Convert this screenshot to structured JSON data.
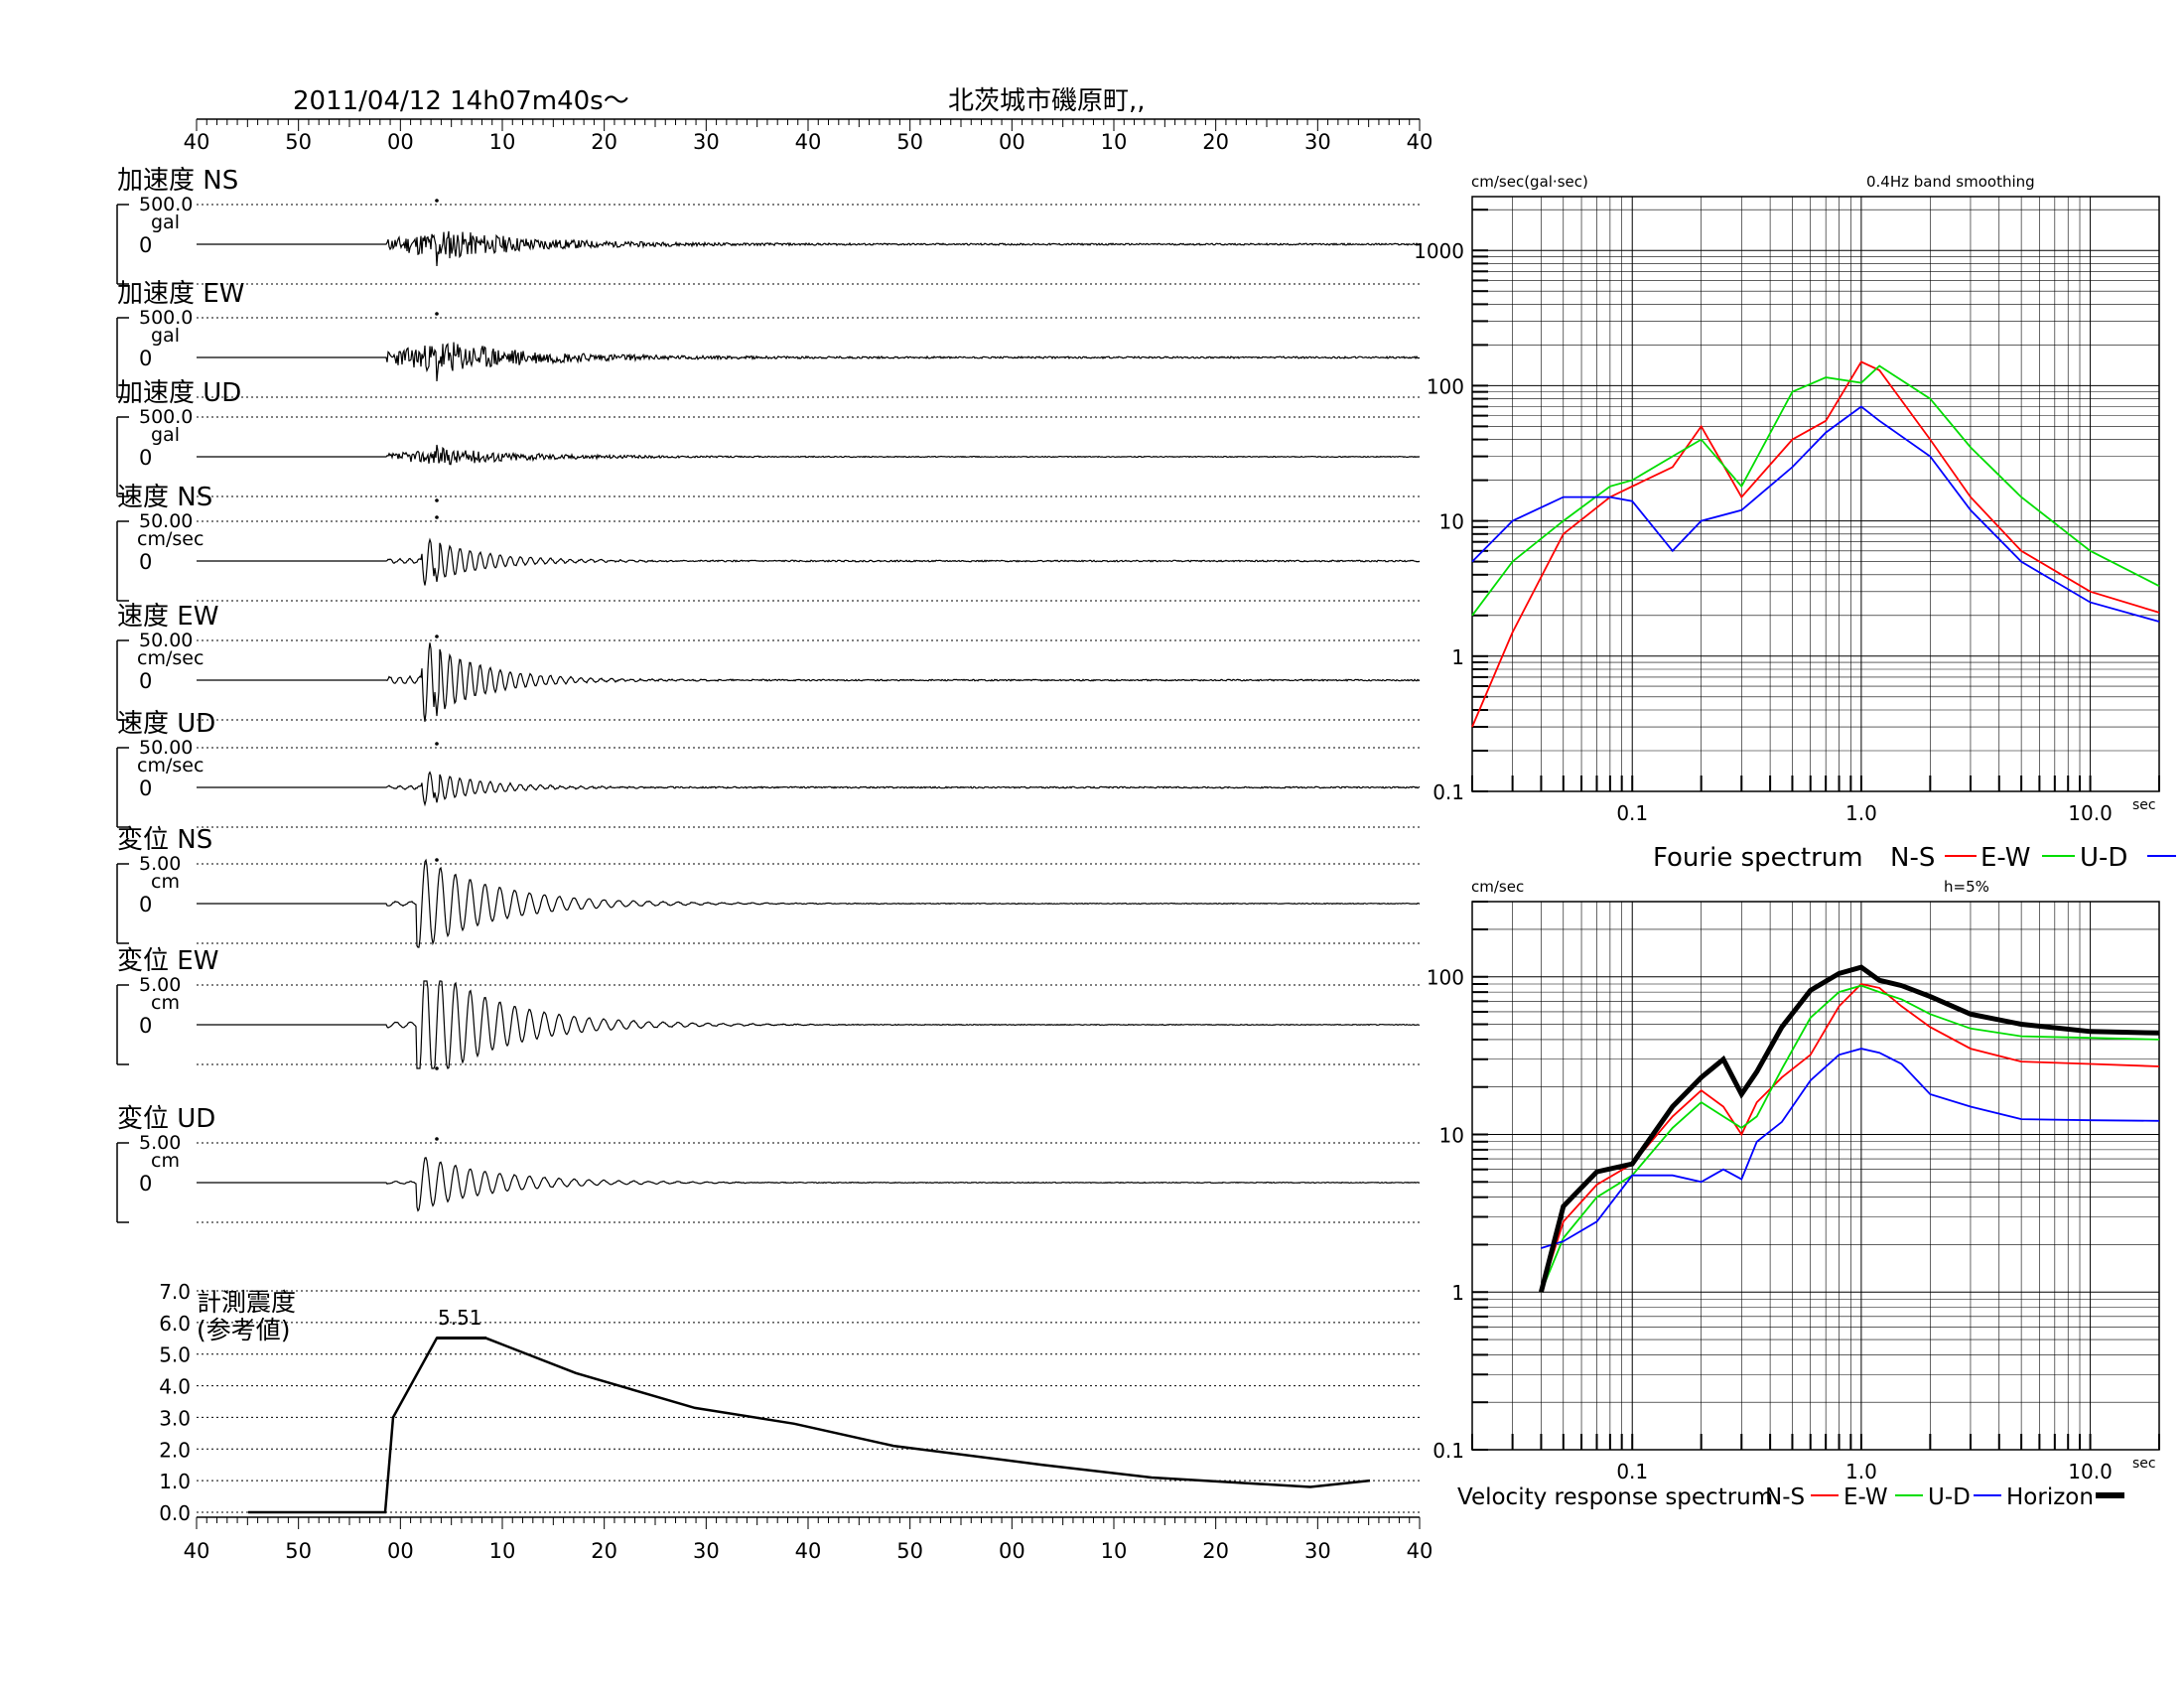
{
  "header": {
    "datetime": "2011/04/12  14h07m40s～",
    "location": "北茨城市磯原町,,"
  },
  "time_axis": {
    "tick_labels": [
      "40",
      "50",
      "00",
      "10",
      "20",
      "30",
      "40",
      "50",
      "00",
      "10",
      "20",
      "30",
      "40"
    ]
  },
  "channels": [
    {
      "title": "加速度 NS",
      "scale": "500.0",
      "unit": "gal",
      "zero": "0",
      "kind": "acc",
      "seed": 11,
      "amp": 0.55,
      "peak_dir": 1
    },
    {
      "title": "加速度 EW",
      "scale": "500.0",
      "unit": "gal",
      "zero": "0",
      "kind": "acc",
      "seed": 23,
      "amp": 0.6,
      "peak_dir": 1
    },
    {
      "title": "加速度 UD",
      "scale": "500.0",
      "unit": "gal",
      "zero": "0",
      "kind": "acc",
      "seed": 37,
      "amp": 0.3,
      "peak_dir": -1
    },
    {
      "title": "速度 NS",
      "scale": "50.00",
      "unit": "cm/sec",
      "zero": "0",
      "kind": "vel",
      "seed": 41,
      "amp": 0.55,
      "peak_dir": 1
    },
    {
      "title": "速度 EW",
      "scale": "50.00",
      "unit": "cm/sec",
      "zero": "0",
      "kind": "vel",
      "seed": 53,
      "amp": 0.95,
      "peak_dir": 1
    },
    {
      "title": "速度 UD",
      "scale": "50.00",
      "unit": "cm/sec",
      "zero": "0",
      "kind": "vel",
      "seed": 67,
      "amp": 0.4,
      "peak_dir": 1
    },
    {
      "title": "変位 NS",
      "scale": "5.00",
      "unit": "cm",
      "zero": "0",
      "kind": "dis",
      "seed": 71,
      "amp": 0.95,
      "peak_dir": 1
    },
    {
      "title": "変位 EW",
      "scale": "5.00",
      "unit": "cm",
      "zero": "0",
      "kind": "dis",
      "seed": 83,
      "amp": 1.35,
      "peak_dir": -1
    },
    {
      "title": "変位 UD",
      "scale": "5.00",
      "unit": "cm",
      "zero": "0",
      "kind": "dis",
      "seed": 97,
      "amp": 0.55,
      "peak_dir": 1
    }
  ],
  "intensity_panel": {
    "title_line1": "計測震度",
    "title_line2": "(参考値)",
    "peak_label": "5.51",
    "y_tick_labels": [
      "7.0",
      "6.0",
      "5.0",
      "4.0",
      "3.0",
      "2.0",
      "1.0",
      "0.0"
    ]
  },
  "fourier_panel": {
    "unit_label": "cm/sec(gal·sec)",
    "note": "0.4Hz band smoothing",
    "y_tick_labels": [
      "1000",
      "100",
      "10",
      "1",
      "0.1"
    ],
    "x_tick_labels": [
      "0.1",
      "1.0",
      "10.0"
    ],
    "x_unit": "sec",
    "legend_title": "Fourie spectrum",
    "legend": [
      "N-S",
      "E-W",
      "U-D"
    ]
  },
  "response_panel": {
    "unit_label": "cm/sec",
    "note": "h=5%",
    "y_tick_labels": [
      "100",
      "10",
      "1",
      "0.1"
    ],
    "x_tick_labels": [
      "0.1",
      "1.0",
      "10.0"
    ],
    "x_unit": "sec",
    "legend_title": "Velocity response spectrum",
    "legend": [
      "N-S",
      "E-W",
      "U-D",
      "Horizon"
    ]
  },
  "colors": {
    "ns": "#ff0000",
    "ew": "#00dd00",
    "ud": "#0000ff",
    "horizon": "#000000"
  },
  "chart_data": [
    {
      "type": "line",
      "title": "計測震度 (参考値)",
      "x": [
        "14h07m40s",
        "14h08m00s",
        "14h08m02s",
        "14h08m04s",
        "14h08m10s",
        "14h08m20s",
        "14h08m30s",
        "14h08m40s",
        "14h08m50s",
        "14h09m10s",
        "14h09m20s",
        "14h09m30s",
        "14h09m40s"
      ],
      "values": [
        0.0,
        0.0,
        3.0,
        5.51,
        5.5,
        4.4,
        3.3,
        2.8,
        2.1,
        1.5,
        1.1,
        0.8,
        1.0
      ],
      "ylim": [
        0,
        7
      ],
      "peak": 5.51
    },
    {
      "type": "line",
      "title": "Fourie spectrum",
      "xlabel": "sec",
      "ylabel": "cm/sec(gal·sec)",
      "x_scale": "log",
      "y_scale": "log",
      "xlim": [
        0.02,
        20
      ],
      "ylim": [
        0.1,
        2500
      ],
      "x": [
        0.02,
        0.03,
        0.05,
        0.08,
        0.1,
        0.15,
        0.2,
        0.3,
        0.5,
        0.7,
        1.0,
        1.2,
        2.0,
        3.0,
        5.0,
        10.0,
        20.0
      ],
      "series": [
        {
          "name": "N-S",
          "values": [
            0.3,
            1.5,
            8,
            15,
            18,
            25,
            50,
            15,
            40,
            55,
            150,
            130,
            40,
            15,
            6,
            3,
            2.1
          ]
        },
        {
          "name": "E-W",
          "values": [
            2,
            5,
            10,
            18,
            20,
            30,
            40,
            18,
            90,
            115,
            105,
            140,
            80,
            35,
            15,
            6,
            3.3
          ]
        },
        {
          "name": "U-D",
          "values": [
            5,
            10,
            15,
            15,
            14,
            6,
            10,
            12,
            25,
            45,
            70,
            55,
            30,
            12,
            5,
            2.5,
            1.8
          ]
        }
      ]
    },
    {
      "type": "line",
      "title": "Velocity response spectrum",
      "xlabel": "sec",
      "ylabel": "cm/sec",
      "x_scale": "log",
      "y_scale": "log",
      "xlim": [
        0.02,
        20
      ],
      "ylim": [
        0.1,
        300
      ],
      "x": [
        0.04,
        0.05,
        0.07,
        0.1,
        0.15,
        0.2,
        0.25,
        0.3,
        0.35,
        0.45,
        0.6,
        0.8,
        1.0,
        1.2,
        1.5,
        2.0,
        3.0,
        5.0,
        10.0,
        20.0
      ],
      "series": [
        {
          "name": "N-S",
          "values": [
            1.0,
            2.8,
            4.8,
            6.5,
            13,
            19,
            15,
            10,
            16,
            23,
            32,
            65,
            90,
            85,
            65,
            48,
            35,
            29,
            28,
            27
          ]
        },
        {
          "name": "E-W",
          "values": [
            1.0,
            2.2,
            4.0,
            5.5,
            11,
            16,
            13,
            11,
            13,
            26,
            55,
            80,
            88,
            80,
            72,
            58,
            47,
            42,
            41,
            40
          ]
        },
        {
          "name": "U-D",
          "values": [
            1.9,
            2.1,
            2.8,
            5.5,
            5.5,
            5.0,
            6.0,
            5.2,
            9.0,
            12,
            22,
            32,
            35,
            33,
            28,
            18,
            15,
            12.5,
            12.3,
            12.2
          ]
        },
        {
          "name": "Horizon",
          "values": [
            1.0,
            3.5,
            5.8,
            6.5,
            15,
            23,
            30,
            18,
            25,
            48,
            82,
            105,
            115,
            95,
            88,
            75,
            58,
            50,
            45,
            44
          ]
        }
      ]
    }
  ]
}
